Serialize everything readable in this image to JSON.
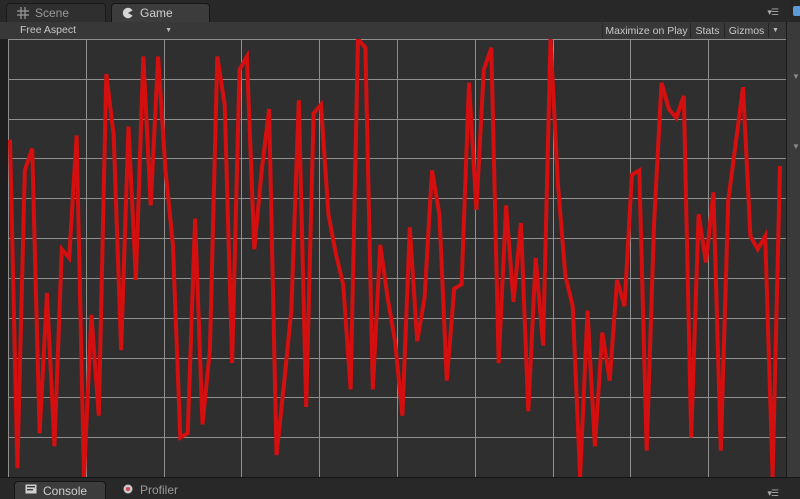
{
  "tabs": {
    "scene_label": "Scene",
    "game_label": "Game"
  },
  "toolbar": {
    "aspect_value": "Free Aspect",
    "maximize_label": "Maximize on Play",
    "stats_label": "Stats",
    "gizmos_label": "Gizmos"
  },
  "bottom_tabs": {
    "console_label": "Console",
    "profiler_label": "Profiler"
  },
  "colors": {
    "line": "#d40f0f",
    "grid": "#8f8f8f",
    "background": "#2f2f2f"
  },
  "chart_data": {
    "type": "line",
    "grid": true,
    "xlim": [
      0,
      100
    ],
    "ylim": [
      0,
      1
    ],
    "series": [
      {
        "values": [
          0.77,
          0.02,
          0.7,
          0.75,
          0.1,
          0.42,
          0.07,
          0.52,
          0.5,
          0.78,
          0.0,
          0.37,
          0.14,
          0.92,
          0.78,
          0.29,
          0.8,
          0.45,
          0.96,
          0.62,
          0.96,
          0.7,
          0.53,
          0.09,
          0.1,
          0.59,
          0.12,
          0.29,
          0.96,
          0.85,
          0.26,
          0.93,
          0.96,
          0.52,
          0.7,
          0.84,
          0.05,
          0.21,
          0.38,
          0.86,
          0.16,
          0.83,
          0.85,
          0.6,
          0.51,
          0.44,
          0.2,
          1.0,
          0.98,
          0.2,
          0.53,
          0.41,
          0.31,
          0.14,
          0.57,
          0.31,
          0.41,
          0.7,
          0.6,
          0.22,
          0.43,
          0.44,
          0.9,
          0.61,
          0.93,
          0.98,
          0.26,
          0.62,
          0.4,
          0.58,
          0.15,
          0.5,
          0.3,
          1.0,
          0.67,
          0.46,
          0.39,
          0.0,
          0.38,
          0.07,
          0.33,
          0.22,
          0.45,
          0.39,
          0.69,
          0.7,
          0.06,
          0.58,
          0.9,
          0.84,
          0.82,
          0.87,
          0.09,
          0.6,
          0.49,
          0.65,
          0.06,
          0.63,
          0.76,
          0.89,
          0.55,
          0.52,
          0.55,
          0.0,
          0.71
        ]
      }
    ]
  }
}
